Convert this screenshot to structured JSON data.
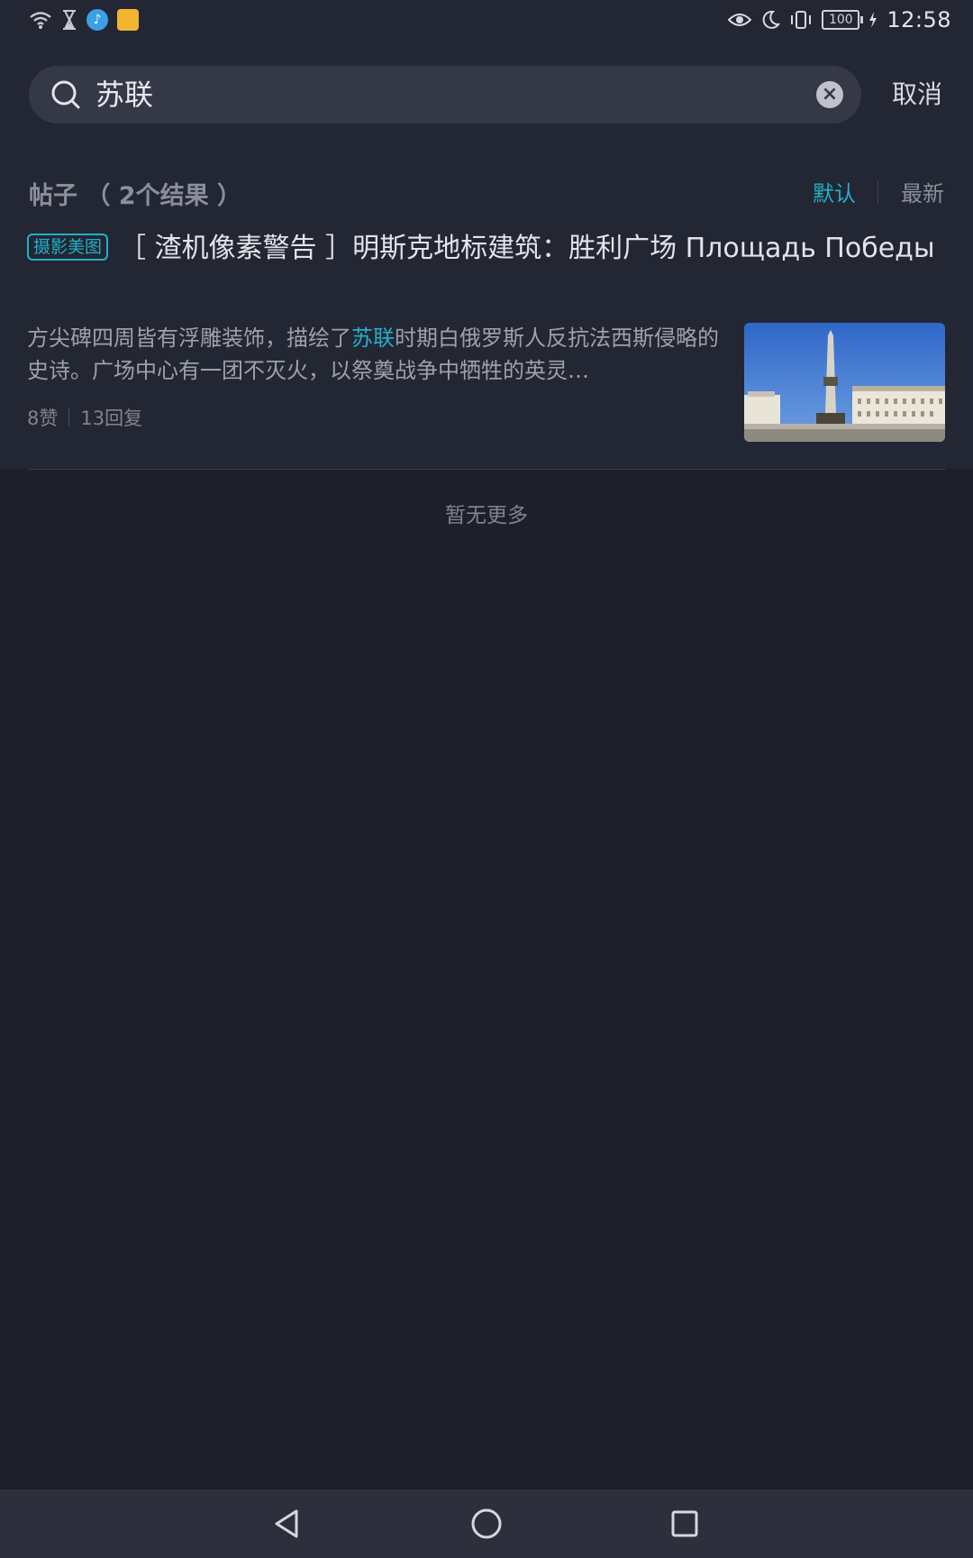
{
  "status_bar": {
    "time": "12:58",
    "battery": "100",
    "icons": [
      "wifi-icon",
      "hourglass-icon",
      "app-notification-icon",
      "app-notification-icon-2",
      "eye-comfort-icon",
      "moon-icon",
      "vibrate-icon",
      "battery-icon",
      "charging-icon"
    ]
  },
  "search": {
    "query": "苏联",
    "cancel_label": "取消"
  },
  "results": {
    "section_label": "帖子",
    "count_label": "（ 2个结果 ）",
    "sort_default": "默认",
    "sort_latest": "最新"
  },
  "post": {
    "tag": "摄影美图",
    "title": "［ 渣机像素警告 ］明斯克地标建筑：胜利广场 Площадь Победы",
    "excerpt_before": "方尖碑四周皆有浮雕装饰，描绘了",
    "excerpt_highlight": "苏联",
    "excerpt_after": "时期白俄罗斯人反抗法西斯侵略的史诗。广场中心有一团不灭火，以祭奠战争中牺牲的英灵…",
    "likes": "8赞",
    "replies": "13回复"
  },
  "footer_text": "暂无更多",
  "colors": {
    "accent": "#22b0c8",
    "background": "#1e1f28",
    "surface": "#232633"
  }
}
